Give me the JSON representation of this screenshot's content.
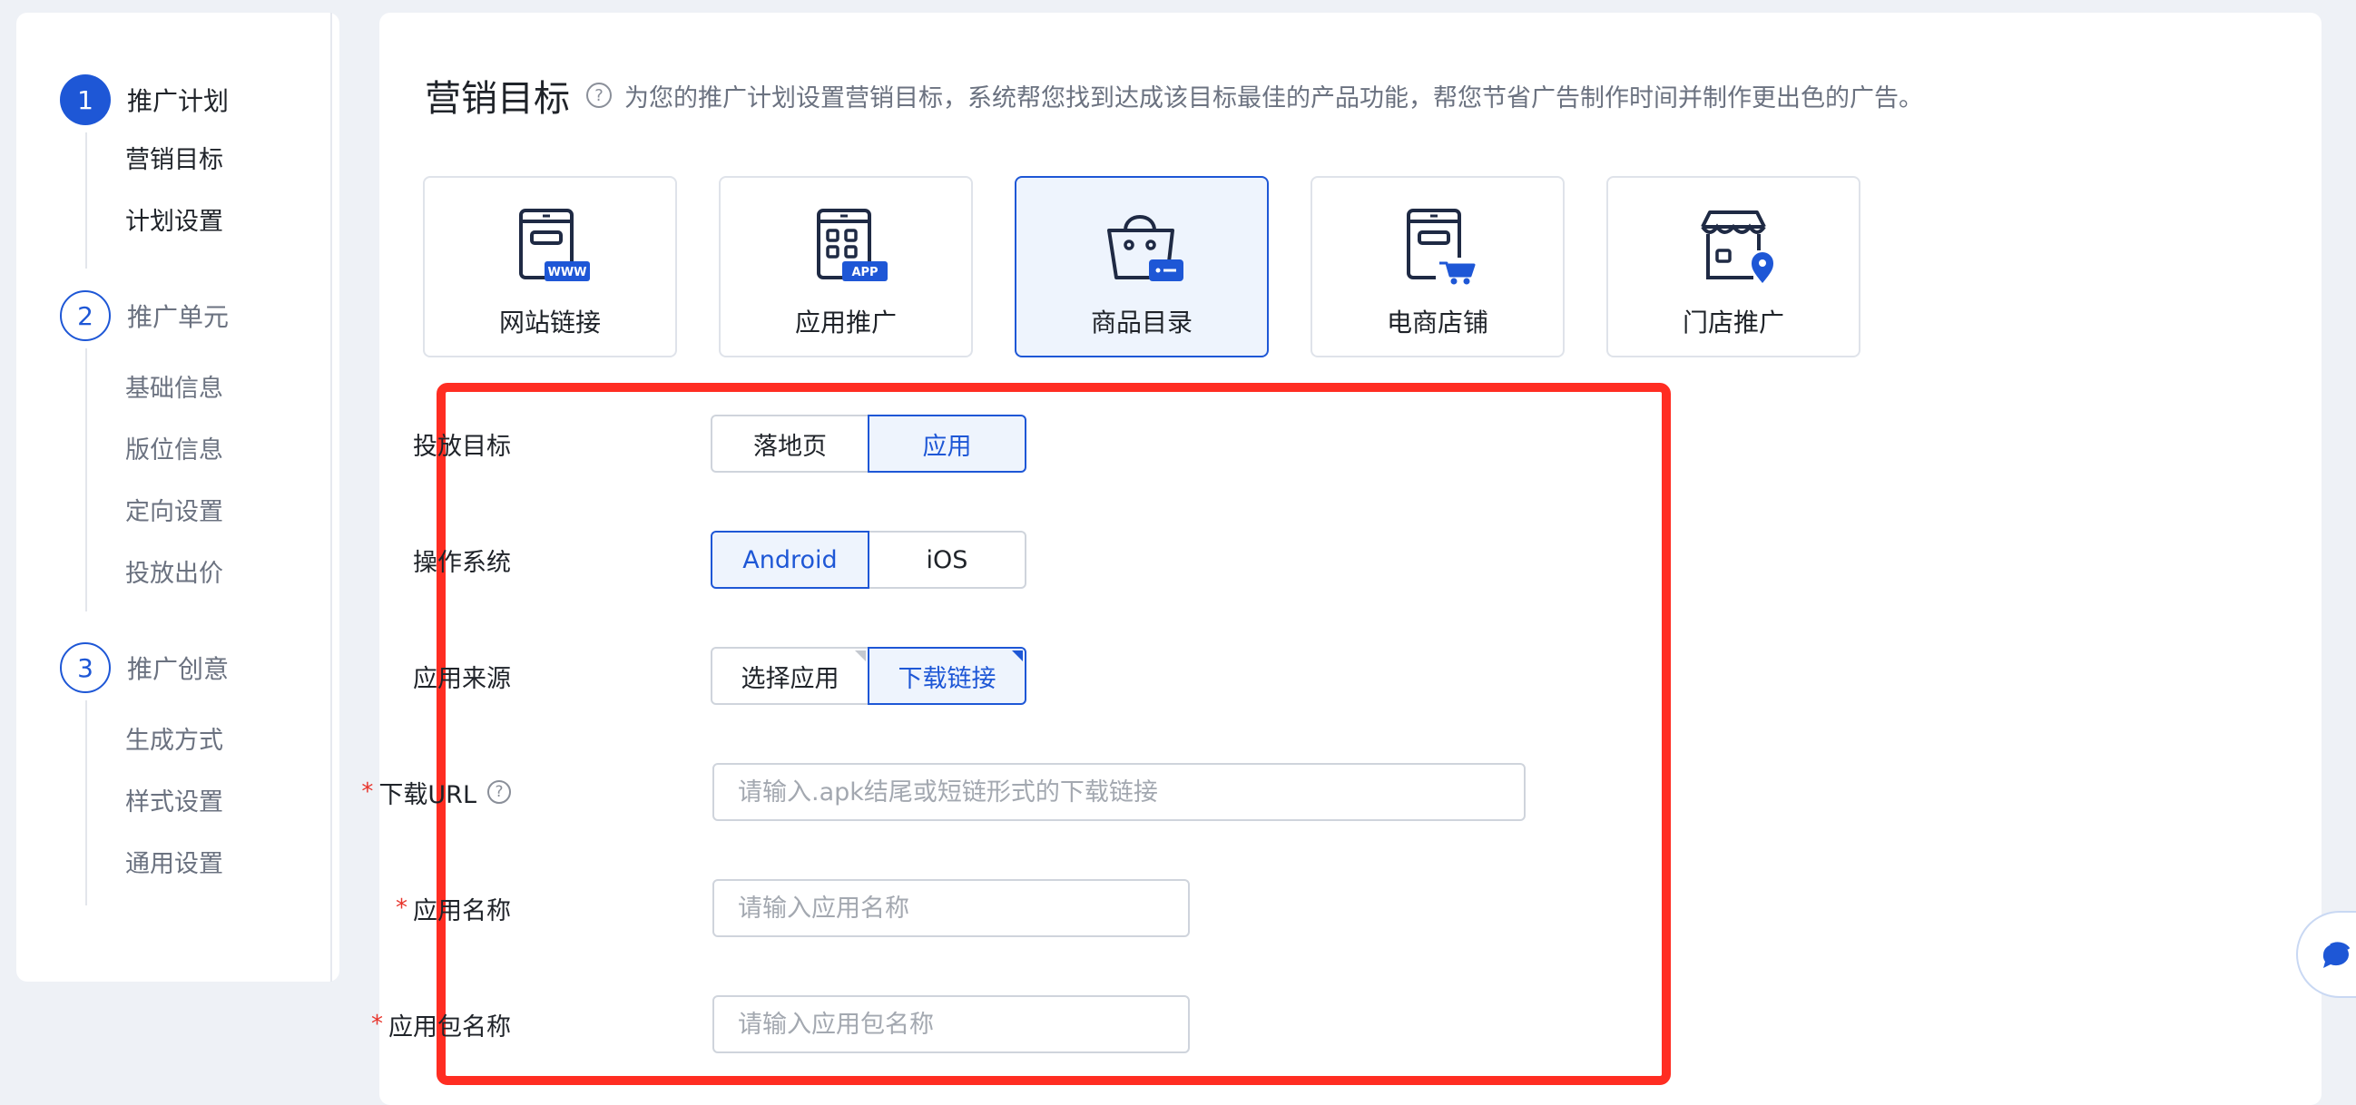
{
  "sidebar": {
    "steps": [
      {
        "number": "1",
        "title": "推广计划",
        "items": [
          "营销目标",
          "计划设置"
        ]
      },
      {
        "number": "2",
        "title": "推广单元",
        "items": [
          "基础信息",
          "版位信息",
          "定向设置",
          "投放出价"
        ]
      },
      {
        "number": "3",
        "title": "推广创意",
        "items": [
          "生成方式",
          "样式设置",
          "通用设置"
        ]
      }
    ]
  },
  "goal": {
    "title": "营销目标",
    "description": "为您的推广计划设置营销目标，系统帮您找到达成该目标最佳的产品功能，帮您节省广告制作时间并制作更出色的广告。",
    "cards": [
      {
        "label": "网站链接",
        "icon": "website-link-icon",
        "badge": "WWW"
      },
      {
        "label": "应用推广",
        "icon": "app-promotion-icon",
        "badge": "APP"
      },
      {
        "label": "商品目录",
        "icon": "product-catalog-icon",
        "selected": true
      },
      {
        "label": "电商店铺",
        "icon": "ecommerce-store-icon"
      },
      {
        "label": "门店推广",
        "icon": "store-promotion-icon"
      }
    ]
  },
  "form": {
    "target": {
      "label": "投放目标",
      "options": [
        "落地页",
        "应用"
      ],
      "selected": "应用"
    },
    "os": {
      "label": "操作系统",
      "options": [
        "Android",
        "iOS"
      ],
      "selected": "Android"
    },
    "source": {
      "label": "应用来源",
      "options": [
        "选择应用",
        "下载链接"
      ],
      "selected": "下载链接"
    },
    "download_url": {
      "label": "下载URL",
      "required": "*",
      "placeholder": "请输入.apk结尾或短链形式的下载链接",
      "value": ""
    },
    "app_name": {
      "label": "应用名称",
      "required": "*",
      "placeholder": "请输入应用名称",
      "value": ""
    },
    "package_name": {
      "label": "应用包名称",
      "required": "*",
      "placeholder": "请输入应用包名称",
      "value": ""
    }
  },
  "colors": {
    "accent": "#1e57d6",
    "highlight_border": "#ff2d22",
    "required": "#e8342b",
    "selected_bg": "#eef4fd"
  }
}
